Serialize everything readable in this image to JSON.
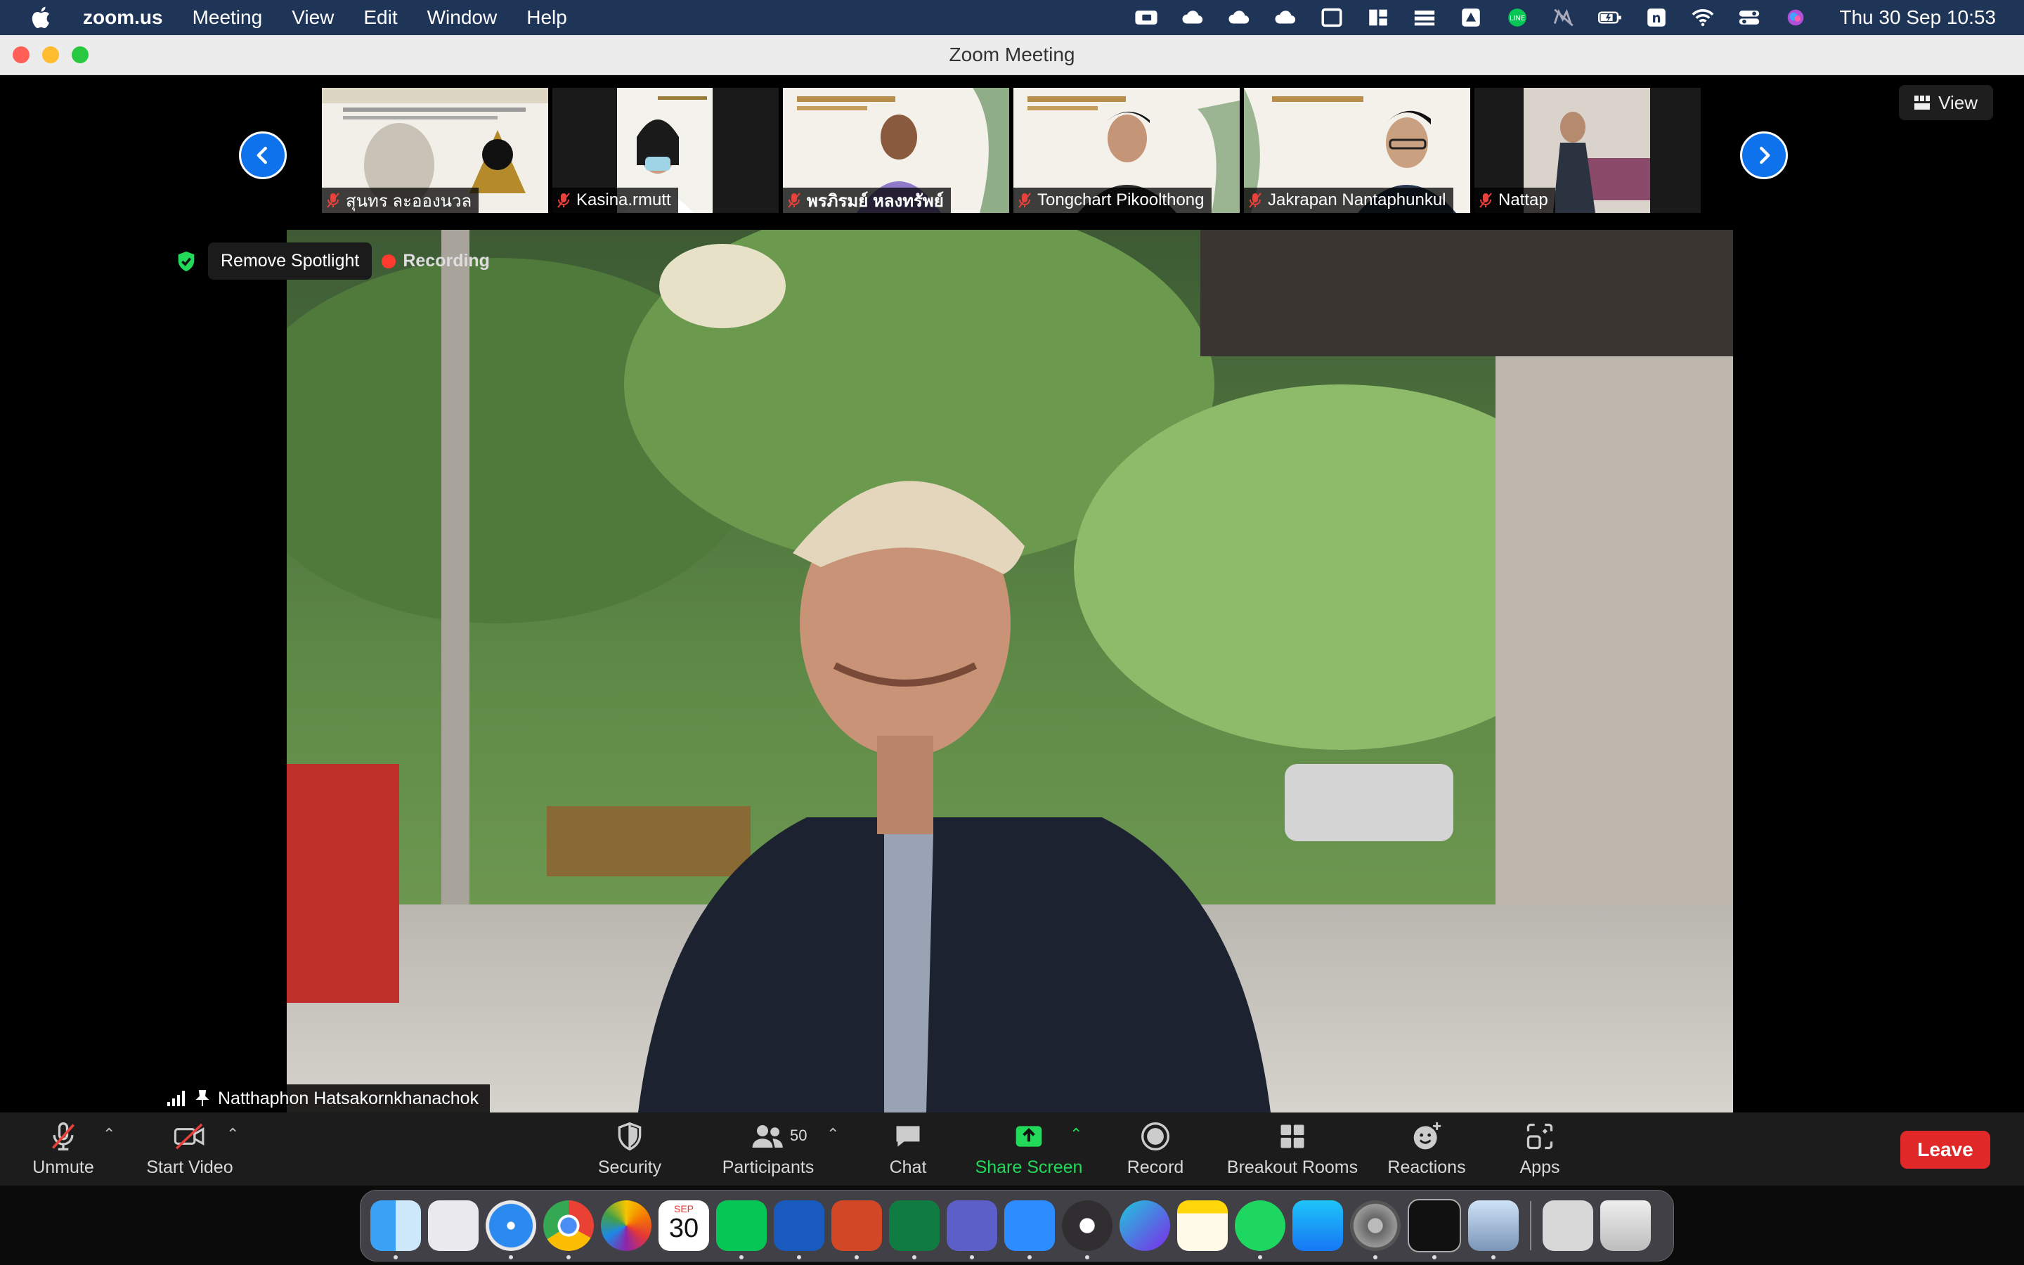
{
  "menubar": {
    "app_name": "zoom.us",
    "menus": [
      "Meeting",
      "View",
      "Edit",
      "Window",
      "Help"
    ],
    "clock": "Thu 30 Sep  10:53"
  },
  "window": {
    "title": "Zoom Meeting"
  },
  "view_button": {
    "label": "View"
  },
  "participants_strip": [
    {
      "name": "สุนทร ละอองนวล"
    },
    {
      "name": "Kasina.rmutt"
    },
    {
      "name": "พรภิรมย์ หลงทรัพย์"
    },
    {
      "name": "Tongchart Pikoolthong"
    },
    {
      "name": "Jakrapan Nantaphunkul"
    },
    {
      "name": "Nattap"
    }
  ],
  "main_video": {
    "spotlight_button": "Remove Spotlight",
    "recording_label": "Recording",
    "speaker_name": "Natthaphon Hatsakornkhanachok"
  },
  "toolbar": {
    "unmute": "Unmute",
    "start_video": "Start Video",
    "security": "Security",
    "participants": "Participants",
    "participants_count": "50",
    "chat": "Chat",
    "share_screen": "Share Screen",
    "record": "Record",
    "breakout_rooms": "Breakout Rooms",
    "reactions": "Reactions",
    "apps": "Apps",
    "leave": "Leave"
  },
  "dock": {
    "calendar_month": "SEP",
    "calendar_day": "30",
    "apps": [
      "Finder",
      "Launchpad",
      "Safari",
      "Chrome",
      "Photos",
      "Calendar",
      "LINE",
      "Word",
      "PowerPoint",
      "Excel",
      "Teams",
      "Zoom",
      "OBS",
      "Canva",
      "Notes",
      "Spotify",
      "App Store",
      "System Preferences",
      "Terminal",
      "Preview",
      "Downloads",
      "Trash"
    ]
  },
  "colors": {
    "menubar_bg": "#1f3557",
    "zoom_blue": "#0e72ed",
    "share_green": "#23d959",
    "leave_red": "#e02828",
    "mute_red": "#e8413b"
  }
}
